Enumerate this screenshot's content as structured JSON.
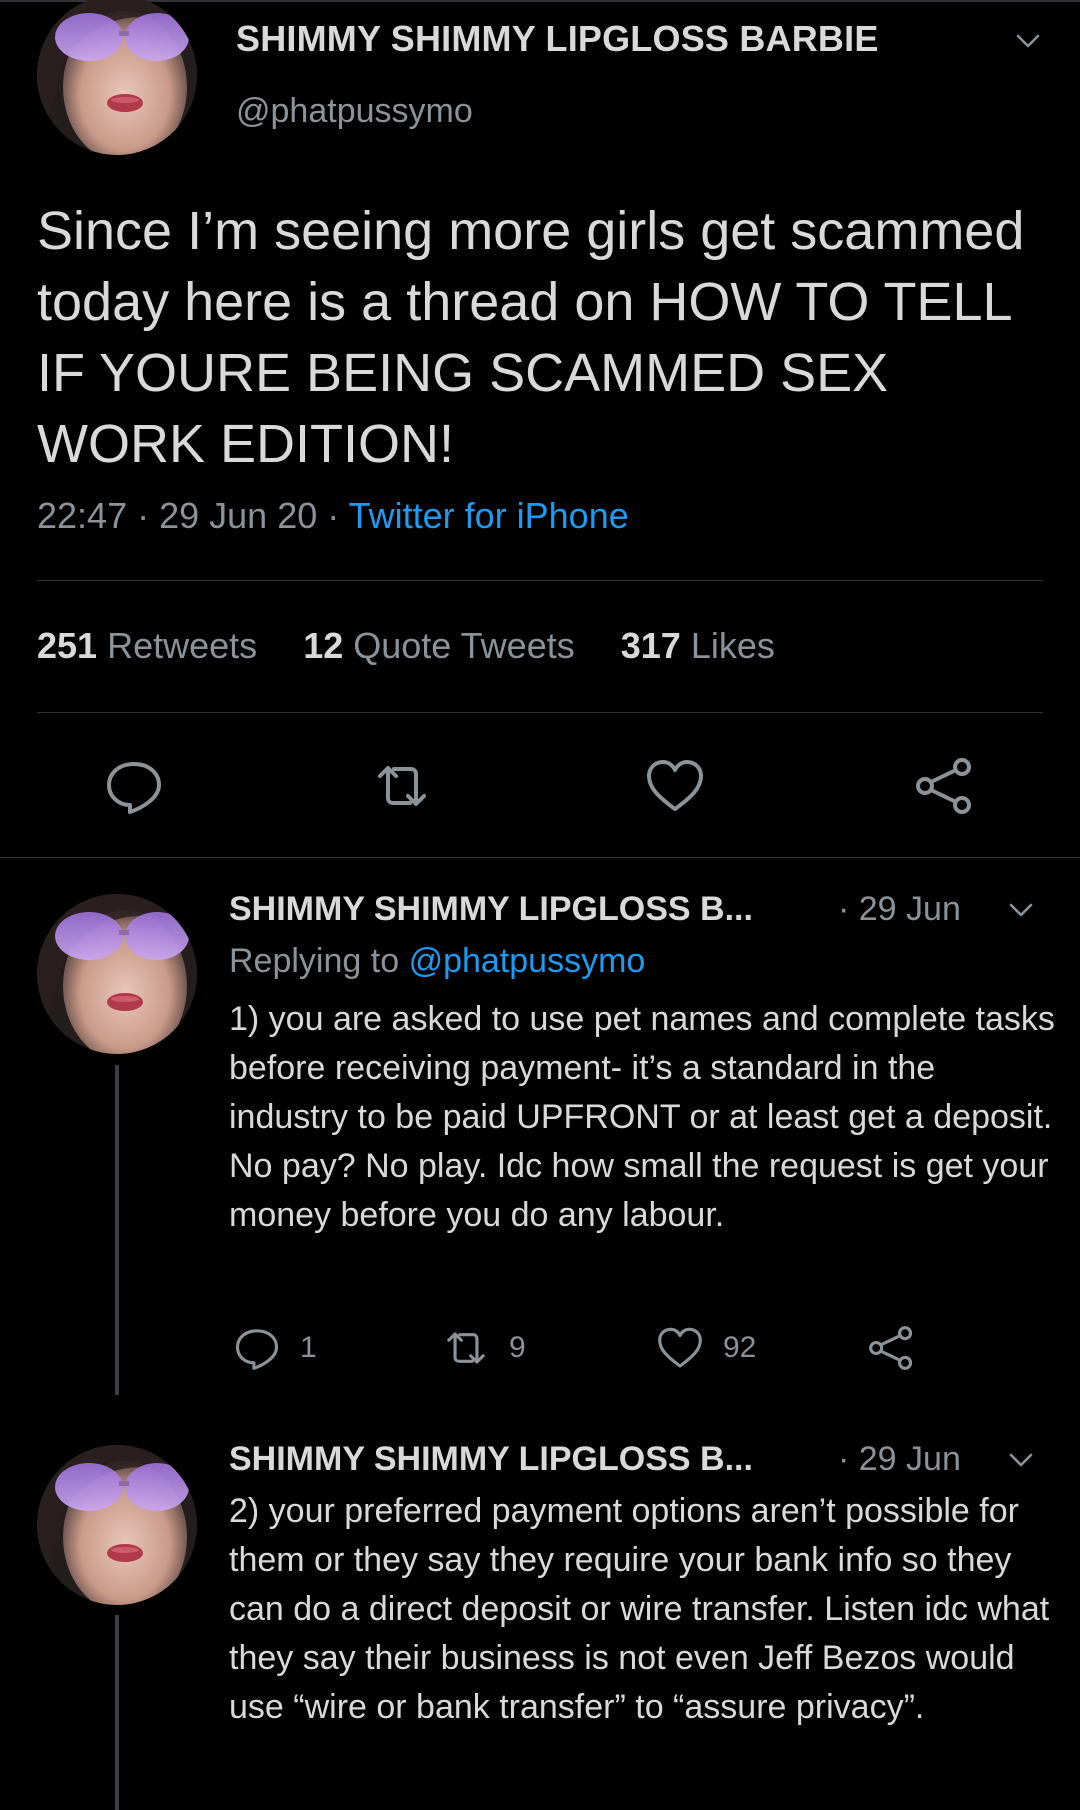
{
  "main_tweet": {
    "display_name": "SHIMMY SHIMMY LIPGLOSS BARBIE",
    "handle": "@phatpussymo",
    "text": "Since I’m seeing more girls get scammed today here is a thread on HOW TO TELL IF YOURE BEING SCAMMED SEX WORK EDITION!",
    "time": "22:47",
    "date": "29 Jun 20",
    "source": "Twitter for iPhone",
    "stats": {
      "retweets_count": "251",
      "retweets_label": "Retweets",
      "quotes_count": "12",
      "quotes_label": "Quote Tweets",
      "likes_count": "317",
      "likes_label": "Likes"
    }
  },
  "replies": [
    {
      "display_name": "SHIMMY SHIMMY LIPGLOSS B...",
      "date": "· 29 Jun",
      "replying_prefix": "Replying to",
      "replying_handle": "@phatpussymo",
      "text": "1) you are asked to use pet names and complete tasks before receiving payment- it’s a standard in the industry to be paid UPFRONT or at least get a deposit. No pay? No play. Idc how small the request is get your money before you do any labour.",
      "reply_count": "1",
      "retweet_count": "9",
      "like_count": "92"
    },
    {
      "display_name": "SHIMMY SHIMMY LIPGLOSS B...",
      "date": "· 29 Jun",
      "text": "2) your preferred payment options aren’t possible for them or they say they require your bank info so they can do a direct deposit or wire transfer. Listen idc what they say their business is not even Jeff Bezos would use “wire or bank transfer” to “assure privacy”."
    }
  ],
  "icons": {
    "chevron": "chevron-down-icon",
    "reply": "reply-icon",
    "retweet": "retweet-icon",
    "like": "heart-icon",
    "share": "share-icon"
  },
  "colors": {
    "background": "#000000",
    "text": "#d9d9d9",
    "secondary": "#8b9298",
    "link": "#1d9bf0",
    "divider": "#2f3336"
  }
}
